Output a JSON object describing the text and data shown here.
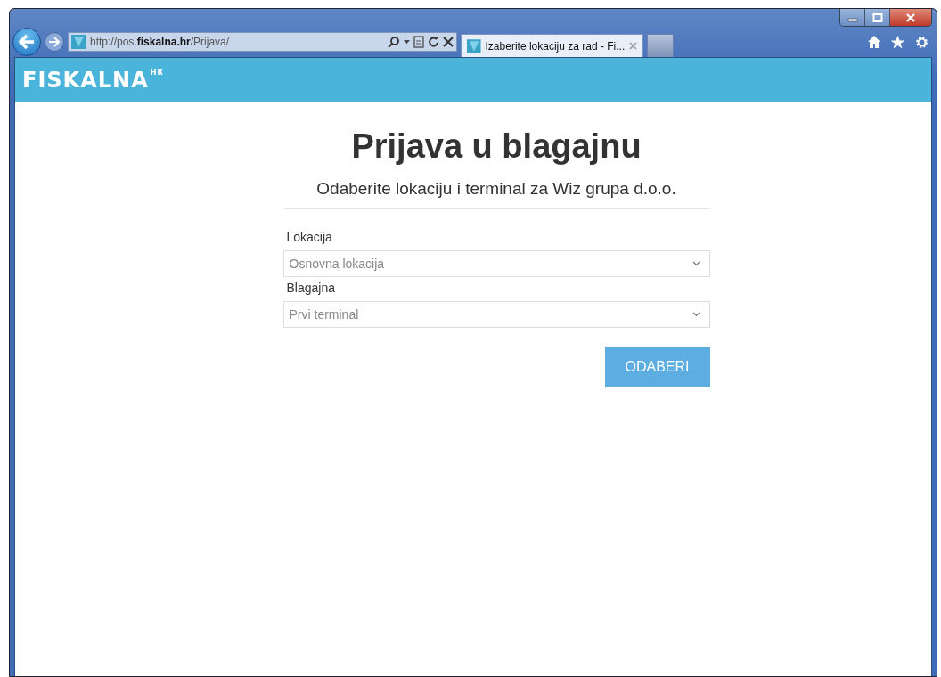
{
  "browser": {
    "address": "http://pos.**fiskalna.hr**/Prijava/",
    "tabs": [
      {
        "title": "Izaberite lokaciju za rad - Fi...",
        "selected": true
      }
    ]
  },
  "header": {
    "logo": "FISKALNA",
    "logo_mark": "HR"
  },
  "form": {
    "title": "Prijava u blagajnu",
    "subtitle": "Odaberite lokaciju i terminal za Wiz grupa d.o.o.",
    "fields": [
      {
        "label": "Lokacija",
        "value": "Osnovna lokacija"
      },
      {
        "label": "Blagajna",
        "value": "Prvi terminal"
      }
    ],
    "button": "ODABERI"
  }
}
